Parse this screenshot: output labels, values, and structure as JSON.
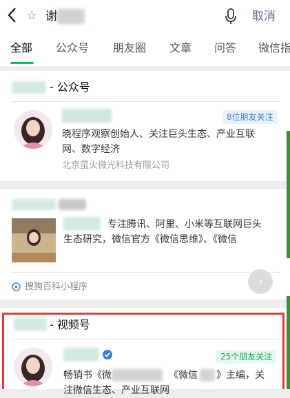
{
  "search": {
    "query": "谢",
    "cancel": "取消"
  },
  "tabs": [
    "全部",
    "公众号",
    "朋友圈",
    "文章",
    "问答",
    "微信指"
  ],
  "official_account": {
    "section_label": "- 公众号",
    "badge": "8位朋友关注",
    "description_line1": "晓程序观察创始人、关注巨头生态、产业互联",
    "description_line2": "网、数字经济",
    "company": "北京萤火微光科技有限公司"
  },
  "baike": {
    "desc_line1": "专注腾讯、阿里、小米等互联网巨头",
    "desc_line2": "生态研究，微信官方《微信思维》、《微信",
    "source": "搜狗百科小程序"
  },
  "video_account": {
    "section_label": "- 视频号",
    "badge": "25个朋友关注",
    "desc_line1_a": "畅销书《微",
    "desc_line1_b": "《微信",
    "desc_line1_c": "》主编，关",
    "desc_line2": "注微信生态、产业互联网"
  },
  "icons": {
    "back": "chevron-left-icon",
    "star": "star-icon",
    "mic": "microphone-icon",
    "verified": "verified-check-icon",
    "compass": "compass-icon",
    "arrow": "arrow-right-icon"
  },
  "colors": {
    "accent_green": "#07c160",
    "highlight_red": "#e33b35",
    "link_blue": "#5f6c8f"
  }
}
